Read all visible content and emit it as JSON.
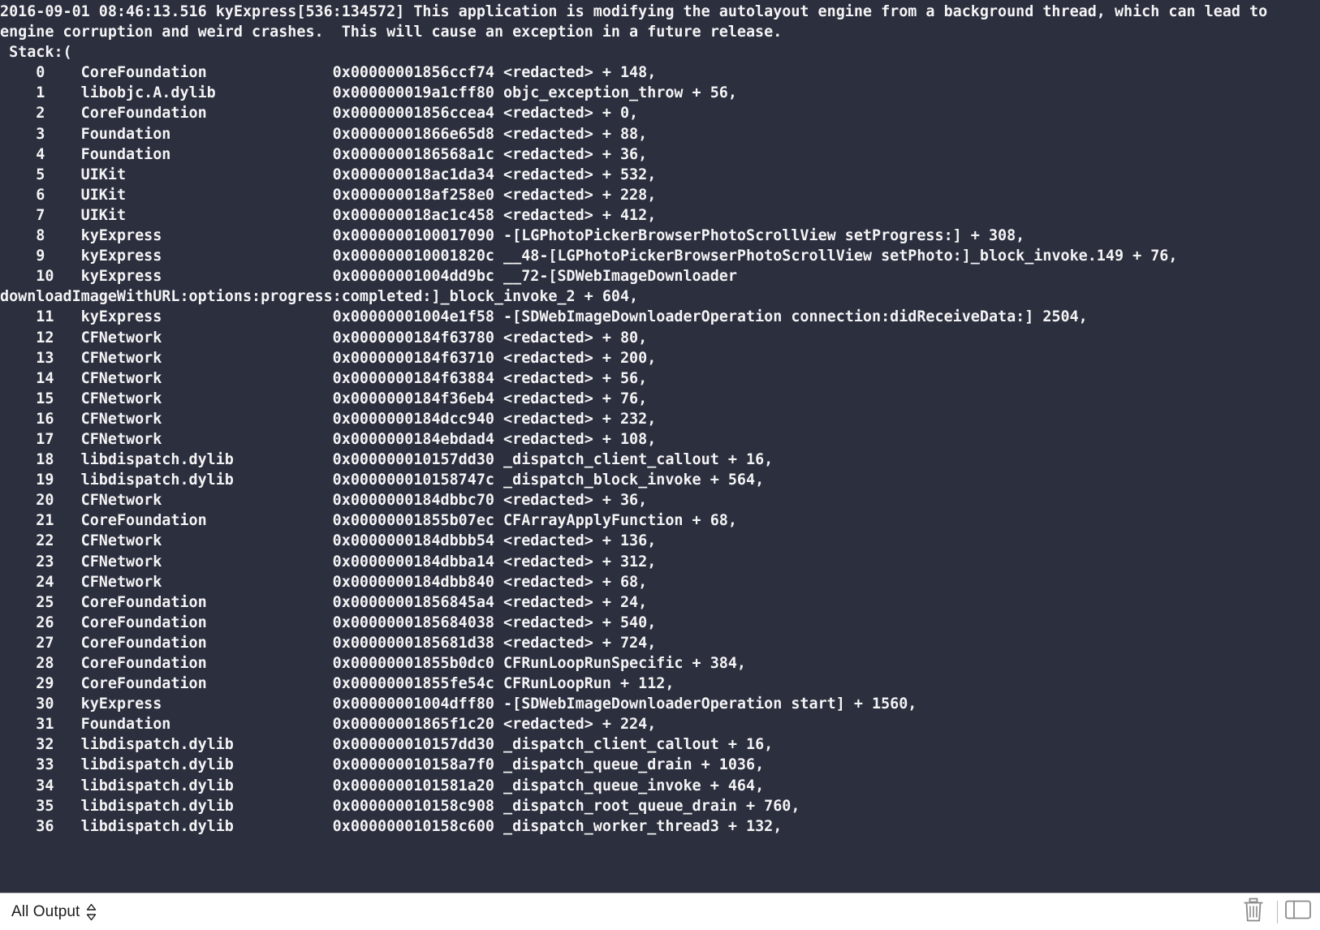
{
  "window": {
    "title": "Xcode Console Output",
    "console_background": "#2b2f3e",
    "console_text_color": "#f4f4f5",
    "statusbar_background": "#ffffff"
  },
  "console": {
    "header_lines": [
      "2016-09-01 08:46:13.516 kyExpress[536:134572] This application is modifying the autolayout engine from a background thread, which can lead to engine corruption and weird crashes.  This will cause an exception in a future release.",
      " Stack:("
    ],
    "frames": [
      {
        "index": "0",
        "binary": "CoreFoundation",
        "address": "0x00000001856ccf74",
        "symbol": "<redacted> + 148,"
      },
      {
        "index": "1",
        "binary": "libobjc.A.dylib",
        "address": "0x000000019a1cff80",
        "symbol": "objc_exception_throw + 56,"
      },
      {
        "index": "2",
        "binary": "CoreFoundation",
        "address": "0x00000001856ccea4",
        "symbol": "<redacted> + 0,"
      },
      {
        "index": "3",
        "binary": "Foundation",
        "address": "0x00000001866e65d8",
        "symbol": "<redacted> + 88,"
      },
      {
        "index": "4",
        "binary": "Foundation",
        "address": "0x0000000186568a1c",
        "symbol": "<redacted> + 36,"
      },
      {
        "index": "5",
        "binary": "UIKit",
        "address": "0x000000018ac1da34",
        "symbol": "<redacted> + 532,"
      },
      {
        "index": "6",
        "binary": "UIKit",
        "address": "0x000000018af258e0",
        "symbol": "<redacted> + 228,"
      },
      {
        "index": "7",
        "binary": "UIKit",
        "address": "0x000000018ac1c458",
        "symbol": "<redacted> + 412,"
      },
      {
        "index": "8",
        "binary": "kyExpress",
        "address": "0x0000000100017090",
        "symbol": "-[LGPhotoPickerBrowserPhotoScrollView setProgress:] + 308,"
      },
      {
        "index": "9",
        "binary": "kyExpress",
        "address": "0x000000010001820c",
        "symbol": "__48-[LGPhotoPickerBrowserPhotoScrollView setPhoto:]_block_invoke.149 + 76,"
      },
      {
        "index": "10",
        "binary": "kyExpress",
        "address": "0x00000001004dd9bc",
        "symbol": "__72-[SDWebImageDownloader downloadImageWithURL:options:progress:completed:]_block_invoke_2 + 604,"
      },
      {
        "index": "11",
        "binary": "kyExpress",
        "address": "0x00000001004e1f58",
        "symbol": "-[SDWebImageDownloaderOperation connection:didReceiveData:] 2504,"
      },
      {
        "index": "12",
        "binary": "CFNetwork",
        "address": "0x0000000184f63780",
        "symbol": "<redacted> + 80,"
      },
      {
        "index": "13",
        "binary": "CFNetwork",
        "address": "0x0000000184f63710",
        "symbol": "<redacted> + 200,"
      },
      {
        "index": "14",
        "binary": "CFNetwork",
        "address": "0x0000000184f63884",
        "symbol": "<redacted> + 56,"
      },
      {
        "index": "15",
        "binary": "CFNetwork",
        "address": "0x0000000184f36eb4",
        "symbol": "<redacted> + 76,"
      },
      {
        "index": "16",
        "binary": "CFNetwork",
        "address": "0x0000000184dcc940",
        "symbol": "<redacted> + 232,"
      },
      {
        "index": "17",
        "binary": "CFNetwork",
        "address": "0x0000000184ebdad4",
        "symbol": "<redacted> + 108,"
      },
      {
        "index": "18",
        "binary": "libdispatch.dylib",
        "address": "0x000000010157dd30",
        "symbol": "_dispatch_client_callout + 16,"
      },
      {
        "index": "19",
        "binary": "libdispatch.dylib",
        "address": "0x000000010158747c",
        "symbol": "_dispatch_block_invoke + 564,"
      },
      {
        "index": "20",
        "binary": "CFNetwork",
        "address": "0x0000000184dbbc70",
        "symbol": "<redacted> + 36,"
      },
      {
        "index": "21",
        "binary": "CoreFoundation",
        "address": "0x00000001855b07ec",
        "symbol": "CFArrayApplyFunction + 68,"
      },
      {
        "index": "22",
        "binary": "CFNetwork",
        "address": "0x0000000184dbbb54",
        "symbol": "<redacted> + 136,"
      },
      {
        "index": "23",
        "binary": "CFNetwork",
        "address": "0x0000000184dbba14",
        "symbol": "<redacted> + 312,"
      },
      {
        "index": "24",
        "binary": "CFNetwork",
        "address": "0x0000000184dbb840",
        "symbol": "<redacted> + 68,"
      },
      {
        "index": "25",
        "binary": "CoreFoundation",
        "address": "0x00000001856845a4",
        "symbol": "<redacted> + 24,"
      },
      {
        "index": "26",
        "binary": "CoreFoundation",
        "address": "0x0000000185684038",
        "symbol": "<redacted> + 540,"
      },
      {
        "index": "27",
        "binary": "CoreFoundation",
        "address": "0x0000000185681d38",
        "symbol": "<redacted> + 724,"
      },
      {
        "index": "28",
        "binary": "CoreFoundation",
        "address": "0x00000001855b0dc0",
        "symbol": "CFRunLoopRunSpecific + 384,"
      },
      {
        "index": "29",
        "binary": "CoreFoundation",
        "address": "0x00000001855fe54c",
        "symbol": "CFRunLoopRun + 112,"
      },
      {
        "index": "30",
        "binary": "kyExpress",
        "address": "0x00000001004dff80",
        "symbol": "-[SDWebImageDownloaderOperation start] + 1560,"
      },
      {
        "index": "31",
        "binary": "Foundation",
        "address": "0x00000001865f1c20",
        "symbol": "<redacted> + 224,"
      },
      {
        "index": "32",
        "binary": "libdispatch.dylib",
        "address": "0x000000010157dd30",
        "symbol": "_dispatch_client_callout + 16,"
      },
      {
        "index": "33",
        "binary": "libdispatch.dylib",
        "address": "0x000000010158a7f0",
        "symbol": "_dispatch_queue_drain + 1036,"
      },
      {
        "index": "34",
        "binary": "libdispatch.dylib",
        "address": "0x0000000101581a20",
        "symbol": "_dispatch_queue_invoke + 464,"
      },
      {
        "index": "35",
        "binary": "libdispatch.dylib",
        "address": "0x000000010158c908",
        "symbol": "_dispatch_root_queue_drain + 760,"
      },
      {
        "index": "36",
        "binary": "libdispatch.dylib",
        "address": "0x000000010158c600",
        "symbol": "_dispatch_worker_thread3 + 132,"
      }
    ]
  },
  "statusbar": {
    "filter_label": "All Output",
    "stepper_icon": "up-down-chevron-icon",
    "clear_icon": "trash-icon",
    "panel_toggle_icon": "panel-toggle-icon"
  }
}
